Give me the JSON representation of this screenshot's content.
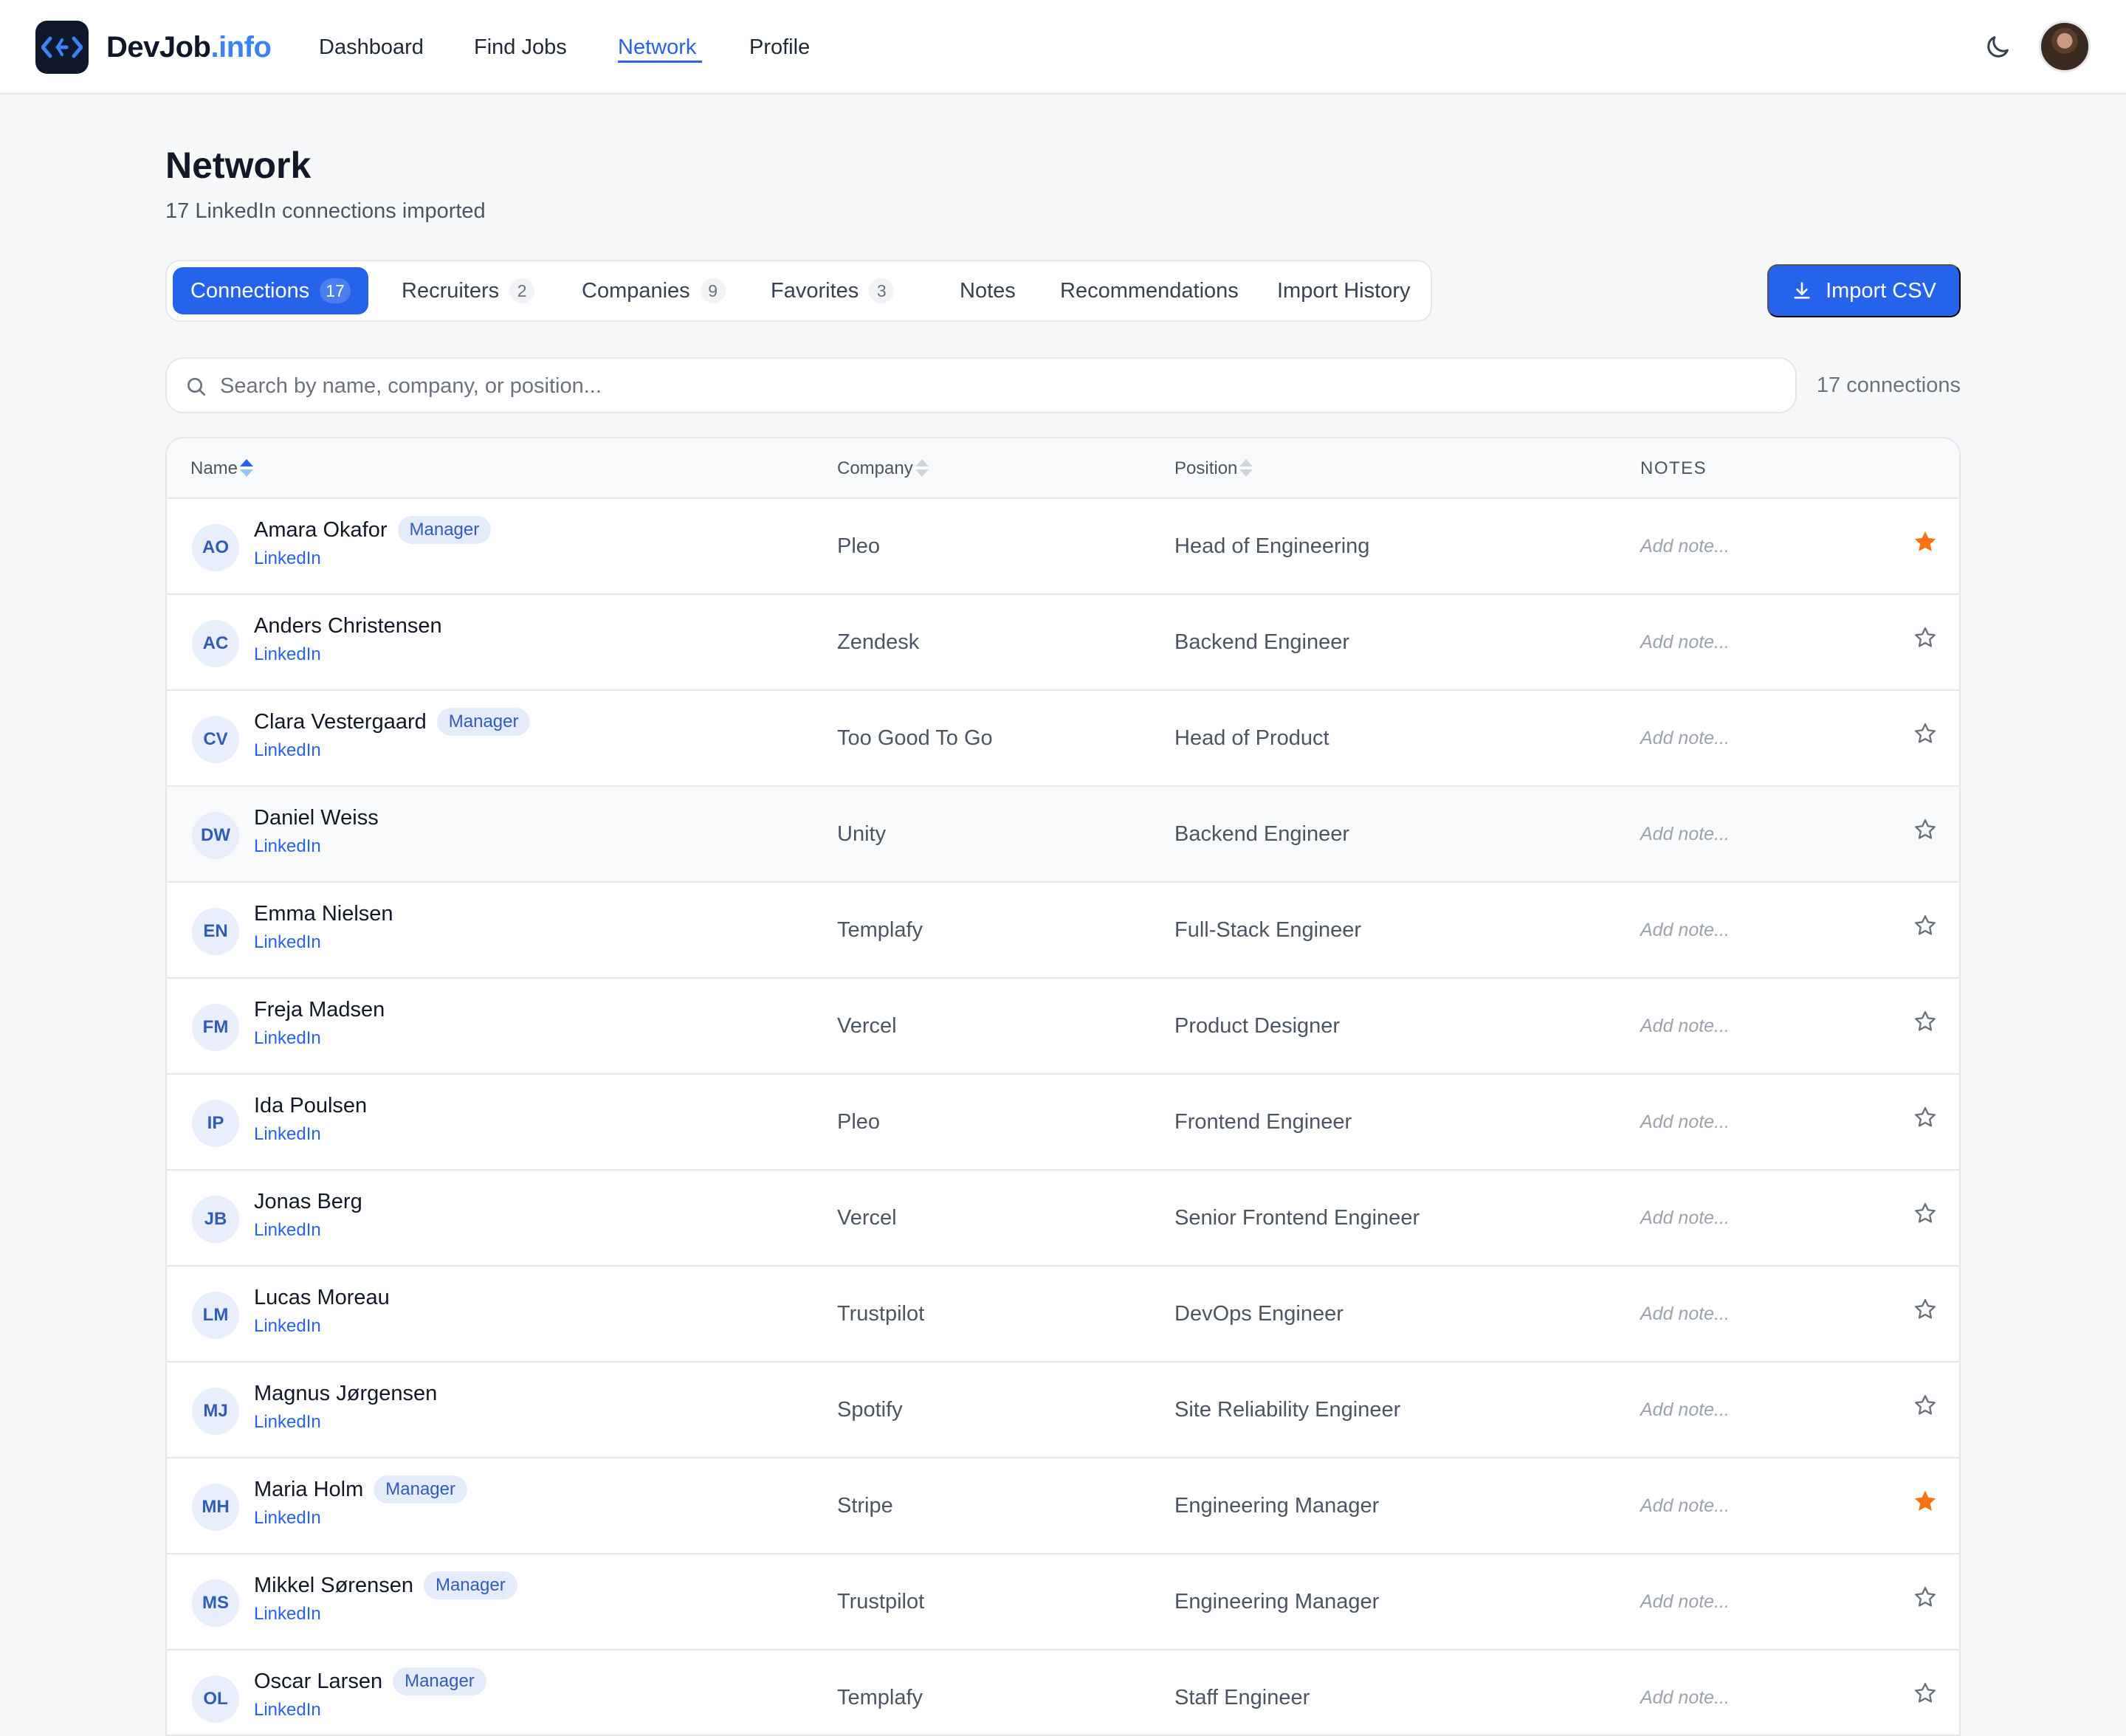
{
  "brand": {
    "name": "DevJob",
    "suffix": ".info"
  },
  "nav": [
    {
      "label": "Dashboard",
      "active": false
    },
    {
      "label": "Find Jobs",
      "active": false
    },
    {
      "label": "Network",
      "active": true
    },
    {
      "label": "Profile",
      "active": false
    }
  ],
  "header": {
    "title": "Network",
    "subtitle": "17 LinkedIn connections imported"
  },
  "tabs": [
    {
      "label": "Connections",
      "count": "17",
      "active": true
    },
    {
      "label": "Recruiters",
      "count": "2"
    },
    {
      "label": "Companies",
      "count": "9"
    },
    {
      "label": "Favorites",
      "count": "3"
    },
    {
      "label": "Notes"
    },
    {
      "label": "Recommendations"
    },
    {
      "label": "Import History"
    }
  ],
  "import_button": {
    "label": "Import CSV",
    "icon": "download-icon"
  },
  "search": {
    "placeholder": "Search by name, company, or position...",
    "value": "",
    "result_count": "17 connections"
  },
  "table": {
    "columns": [
      "Name",
      "Company",
      "Position",
      "NOTES"
    ],
    "sort": {
      "column": "Name",
      "direction": "asc"
    },
    "rows": [
      {
        "initials": "AO",
        "name": "Amara Okafor",
        "badge": "Manager",
        "link": "LinkedIn",
        "company": "Pleo",
        "position": "Head of Engineering",
        "note_placeholder": "Add note...",
        "favorite": true
      },
      {
        "initials": "AC",
        "name": "Anders Christensen",
        "badge": "",
        "link": "LinkedIn",
        "company": "Zendesk",
        "position": "Backend Engineer",
        "note_placeholder": "Add note...",
        "favorite": false
      },
      {
        "initials": "CV",
        "name": "Clara Vestergaard",
        "badge": "Manager",
        "link": "LinkedIn",
        "company": "Too Good To Go",
        "position": "Head of Product",
        "note_placeholder": "Add note...",
        "favorite": false
      },
      {
        "initials": "DW",
        "name": "Daniel Weiss",
        "badge": "",
        "link": "LinkedIn",
        "company": "Unity",
        "position": "Backend Engineer",
        "note_placeholder": "Add note...",
        "favorite": false,
        "hover": true
      },
      {
        "initials": "EN",
        "name": "Emma Nielsen",
        "badge": "",
        "link": "LinkedIn",
        "company": "Templafy",
        "position": "Full-Stack Engineer",
        "note_placeholder": "Add note...",
        "favorite": false
      },
      {
        "initials": "FM",
        "name": "Freja Madsen",
        "badge": "",
        "link": "LinkedIn",
        "company": "Vercel",
        "position": "Product Designer",
        "note_placeholder": "Add note...",
        "favorite": false
      },
      {
        "initials": "IP",
        "name": "Ida Poulsen",
        "badge": "",
        "link": "LinkedIn",
        "company": "Pleo",
        "position": "Frontend Engineer",
        "note_placeholder": "Add note...",
        "favorite": false
      },
      {
        "initials": "JB",
        "name": "Jonas Berg",
        "badge": "",
        "link": "LinkedIn",
        "company": "Vercel",
        "position": "Senior Frontend Engineer",
        "note_placeholder": "Add note...",
        "favorite": false
      },
      {
        "initials": "LM",
        "name": "Lucas Moreau",
        "badge": "",
        "link": "LinkedIn",
        "company": "Trustpilot",
        "position": "DevOps Engineer",
        "note_placeholder": "Add note...",
        "favorite": false
      },
      {
        "initials": "MJ",
        "name": "Magnus Jørgensen",
        "badge": "",
        "link": "LinkedIn",
        "company": "Spotify",
        "position": "Site Reliability Engineer",
        "note_placeholder": "Add note...",
        "favorite": false
      },
      {
        "initials": "MH",
        "name": "Maria Holm",
        "badge": "Manager",
        "link": "LinkedIn",
        "company": "Stripe",
        "position": "Engineering Manager",
        "note_placeholder": "Add note...",
        "favorite": true
      },
      {
        "initials": "MS",
        "name": "Mikkel Sørensen",
        "badge": "Manager",
        "link": "LinkedIn",
        "company": "Trustpilot",
        "position": "Engineering Manager",
        "note_placeholder": "Add note...",
        "favorite": false
      },
      {
        "initials": "OL",
        "name": "Oscar Larsen",
        "badge": "Manager",
        "link": "LinkedIn",
        "company": "Templafy",
        "position": "Staff Engineer",
        "note_placeholder": "Add note...",
        "favorite": false
      }
    ]
  },
  "colors": {
    "accent": "#2563eb",
    "favorite_star": "#f97316",
    "badge_bg": "#e4ecfb",
    "badge_text": "#2f5db8"
  }
}
